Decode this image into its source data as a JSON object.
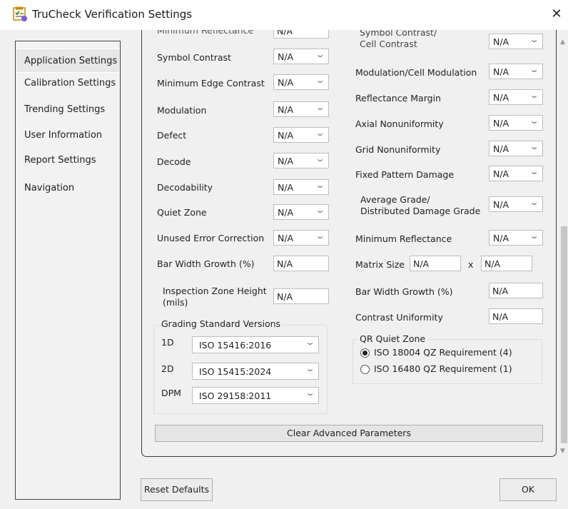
{
  "window": {
    "title": "TruCheck Verification Settings",
    "close": "✕"
  },
  "nav": {
    "items": [
      {
        "label": "Application Settings"
      },
      {
        "label": "Calibration Settings"
      },
      {
        "label": "Trending Settings"
      },
      {
        "label": "User Information"
      },
      {
        "label": "Report Settings"
      },
      {
        "label": "Navigation"
      }
    ]
  },
  "left_params": {
    "partial_top_label": "Minimum Reflectance",
    "partial_top_value": "N/A",
    "symbol_contrast": {
      "label": "Symbol Contrast",
      "value": "N/A"
    },
    "min_edge_contrast": {
      "label": "Minimum Edge Contrast",
      "value": "N/A"
    },
    "modulation": {
      "label": "Modulation",
      "value": "N/A"
    },
    "defect": {
      "label": "Defect",
      "value": "N/A"
    },
    "decode": {
      "label": "Decode",
      "value": "N/A"
    },
    "decodability": {
      "label": "Decodability",
      "value": "N/A"
    },
    "quiet_zone": {
      "label": "Quiet Zone",
      "value": "N/A"
    },
    "unused_ec": {
      "label": "Unused Error Correction",
      "value": "N/A"
    },
    "bar_width_growth": {
      "label": "Bar Width Growth (%)",
      "value": "N/A"
    },
    "inspection_zone": {
      "label_line1": "Inspection Zone Height",
      "label_line2": "(mils)",
      "value": "N/A"
    }
  },
  "right_params": {
    "partial_top_line1": "Symbol Contrast/",
    "partial_top_line2": "Cell Contrast",
    "partial_top_value": "N/A",
    "modulation_cell": {
      "label": "Modulation/Cell Modulation",
      "value": "N/A"
    },
    "reflectance_margin": {
      "label": "Reflectance Margin",
      "value": "N/A"
    },
    "axial_nonuniformity": {
      "label": "Axial Nonuniformity",
      "value": "N/A"
    },
    "grid_nonuniformity": {
      "label": "Grid Nonuniformity",
      "value": "N/A"
    },
    "fixed_pattern_damage": {
      "label": "Fixed Pattern Damage",
      "value": "N/A"
    },
    "average_grade": {
      "label_line1": "Average Grade/",
      "label_line2": "Distributed Damage Grade",
      "value": "N/A"
    },
    "minimum_reflectance": {
      "label": "Minimum Reflectance",
      "value": "N/A"
    },
    "matrix_size": {
      "label": "Matrix Size",
      "value1": "N/A",
      "sep": "x",
      "value2": "N/A"
    },
    "bar_width_growth": {
      "label": "Bar Width Growth (%)",
      "value": "N/A"
    },
    "contrast_uniformity": {
      "label": "Contrast Uniformity",
      "value": "N/A"
    }
  },
  "grading": {
    "title": "Grading Standard Versions",
    "rows": [
      {
        "label": "1D",
        "value": "ISO 15416:2016"
      },
      {
        "label": "2D",
        "value": "ISO 15415:2024"
      },
      {
        "label": "DPM",
        "value": "ISO 29158:2011"
      }
    ]
  },
  "qr_quiet_zone": {
    "title": "QR Quiet Zone",
    "options": [
      {
        "label": "ISO 18004 QZ Requirement (4)",
        "selected": true
      },
      {
        "label": "ISO 16480 QZ Requirement (1)",
        "selected": false
      }
    ]
  },
  "buttons": {
    "clear_advanced": "Clear Advanced Parameters",
    "reset_defaults": "Reset Defaults",
    "ok": "OK"
  },
  "icons": {
    "title_icon": "settings-checklist-icon",
    "chevron": "chevron-down-icon"
  },
  "colors": {
    "window_bg": "#f0f0f0",
    "title_bg": "#ffffff",
    "nav_selected": "#e7e7e7"
  }
}
